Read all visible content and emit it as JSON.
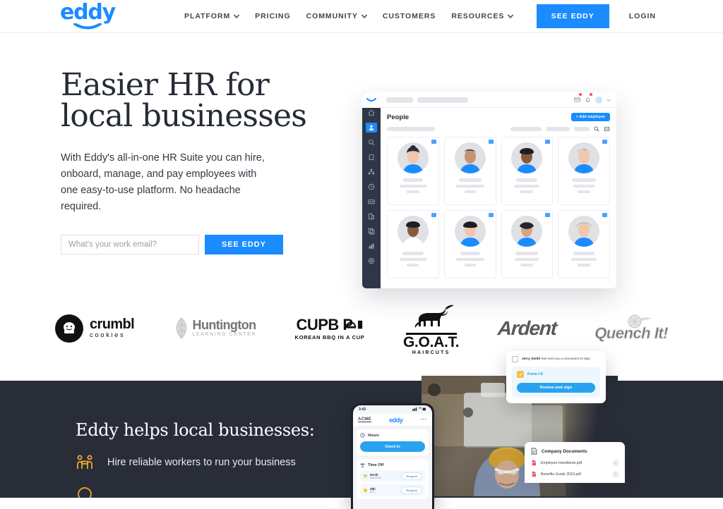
{
  "brand": {
    "name": "eddy",
    "accent": "#1a8cff",
    "dark": "#282d38"
  },
  "header": {
    "nav": [
      {
        "label": "PLATFORM",
        "has_caret": true,
        "icon": "chevron-down-icon"
      },
      {
        "label": "PRICING",
        "has_caret": false
      },
      {
        "label": "COMMUNITY",
        "has_caret": true,
        "icon": "chevron-down-icon"
      },
      {
        "label": "CUSTOMERS",
        "has_caret": false
      },
      {
        "label": "RESOURCES",
        "has_caret": true,
        "icon": "chevron-down-icon"
      }
    ],
    "cta_label": "SEE EDDY",
    "login_label": "LOGIN"
  },
  "hero": {
    "title_line1": "Easier HR for",
    "title_line2": "local businesses",
    "subtitle": "With Eddy's all-in-one HR Suite you can hire, onboard, manage, and pay employees with one easy-to-use platform. No headache required.",
    "email_placeholder": "What's your work email?",
    "email_value": "",
    "cta_label": "SEE EDDY"
  },
  "app_mockup": {
    "page_title": "People",
    "add_button_label": "+ Add employee",
    "sidebar_icons": [
      "home-icon",
      "people-icon",
      "search-circle-icon",
      "clipboard-icon",
      "org-chart-icon",
      "clock-icon",
      "id-card-icon",
      "building-icon",
      "documents-icon",
      "reports-chart-icon",
      "settings-gear-icon"
    ],
    "topbar_icons": [
      "mail-badge-icon",
      "bell-badge-icon",
      "avatar",
      "chevron-down-icon"
    ],
    "toolbar_icons": [
      "search-icon",
      "list-view-icon"
    ],
    "employee_count": 8
  },
  "logos": [
    {
      "name": "crumbl cookies",
      "primary": "crumbl",
      "secondary": "cookies"
    },
    {
      "name": "Huntington Learning Center",
      "primary": "Huntington",
      "secondary": "LEARNING CENTER"
    },
    {
      "name": "Cupbop",
      "primary": "CUPB P",
      "secondary": "KOREAN BBQ IN A CUP"
    },
    {
      "name": "G.O.A.T. Haircuts",
      "primary": "G.O.A.T.",
      "secondary": "HAIRCUTS"
    },
    {
      "name": "Ardent",
      "primary": "Ardent",
      "secondary": ""
    },
    {
      "name": "Quench It!",
      "primary": "Quench It!",
      "secondary": ""
    }
  ],
  "dark_section": {
    "title": "Eddy helps local businesses:",
    "bullets": [
      {
        "text": "Hire reliable workers to run your business",
        "icon": "two-people-icon"
      },
      {
        "text": "",
        "icon": "circle-icon"
      }
    ]
  },
  "phone": {
    "status_time": "3:43",
    "status_icons": "signal-wifi-battery",
    "company": "ACME",
    "brand": "eddy",
    "menu_icon": "more-dots-icon",
    "hours_card": {
      "title": "Hours",
      "icon": "clock-icon",
      "button_label": "Clock In"
    },
    "timeoff_card": {
      "title": "Time Off",
      "icon": "timeoff-icon",
      "rows": [
        {
          "amount": "60.0h",
          "label": "VACATION",
          "button": "Request",
          "icon": "palm-icon"
        },
        {
          "amount": "48h",
          "label": "SICK",
          "button": "Request",
          "icon": "sick-icon"
        }
      ]
    }
  },
  "sign_card": {
    "sender": "Jerry Smith",
    "message": " has sent you a document to sign.",
    "file_name": "Form I-9",
    "file_icon": "signature-icon",
    "button_label": "Review and sign",
    "checkbox_icon": "checkbox-icon"
  },
  "docs_card": {
    "title": "Company Documents",
    "title_icon": "document-icon",
    "files": [
      {
        "name": "Employee Handbook.pdf",
        "icon": "pdf-icon",
        "action_icon": "download-icon"
      },
      {
        "name": "Benefits Guide 2019.pdf",
        "icon": "pdf-icon",
        "action_icon": "download-icon"
      }
    ]
  }
}
